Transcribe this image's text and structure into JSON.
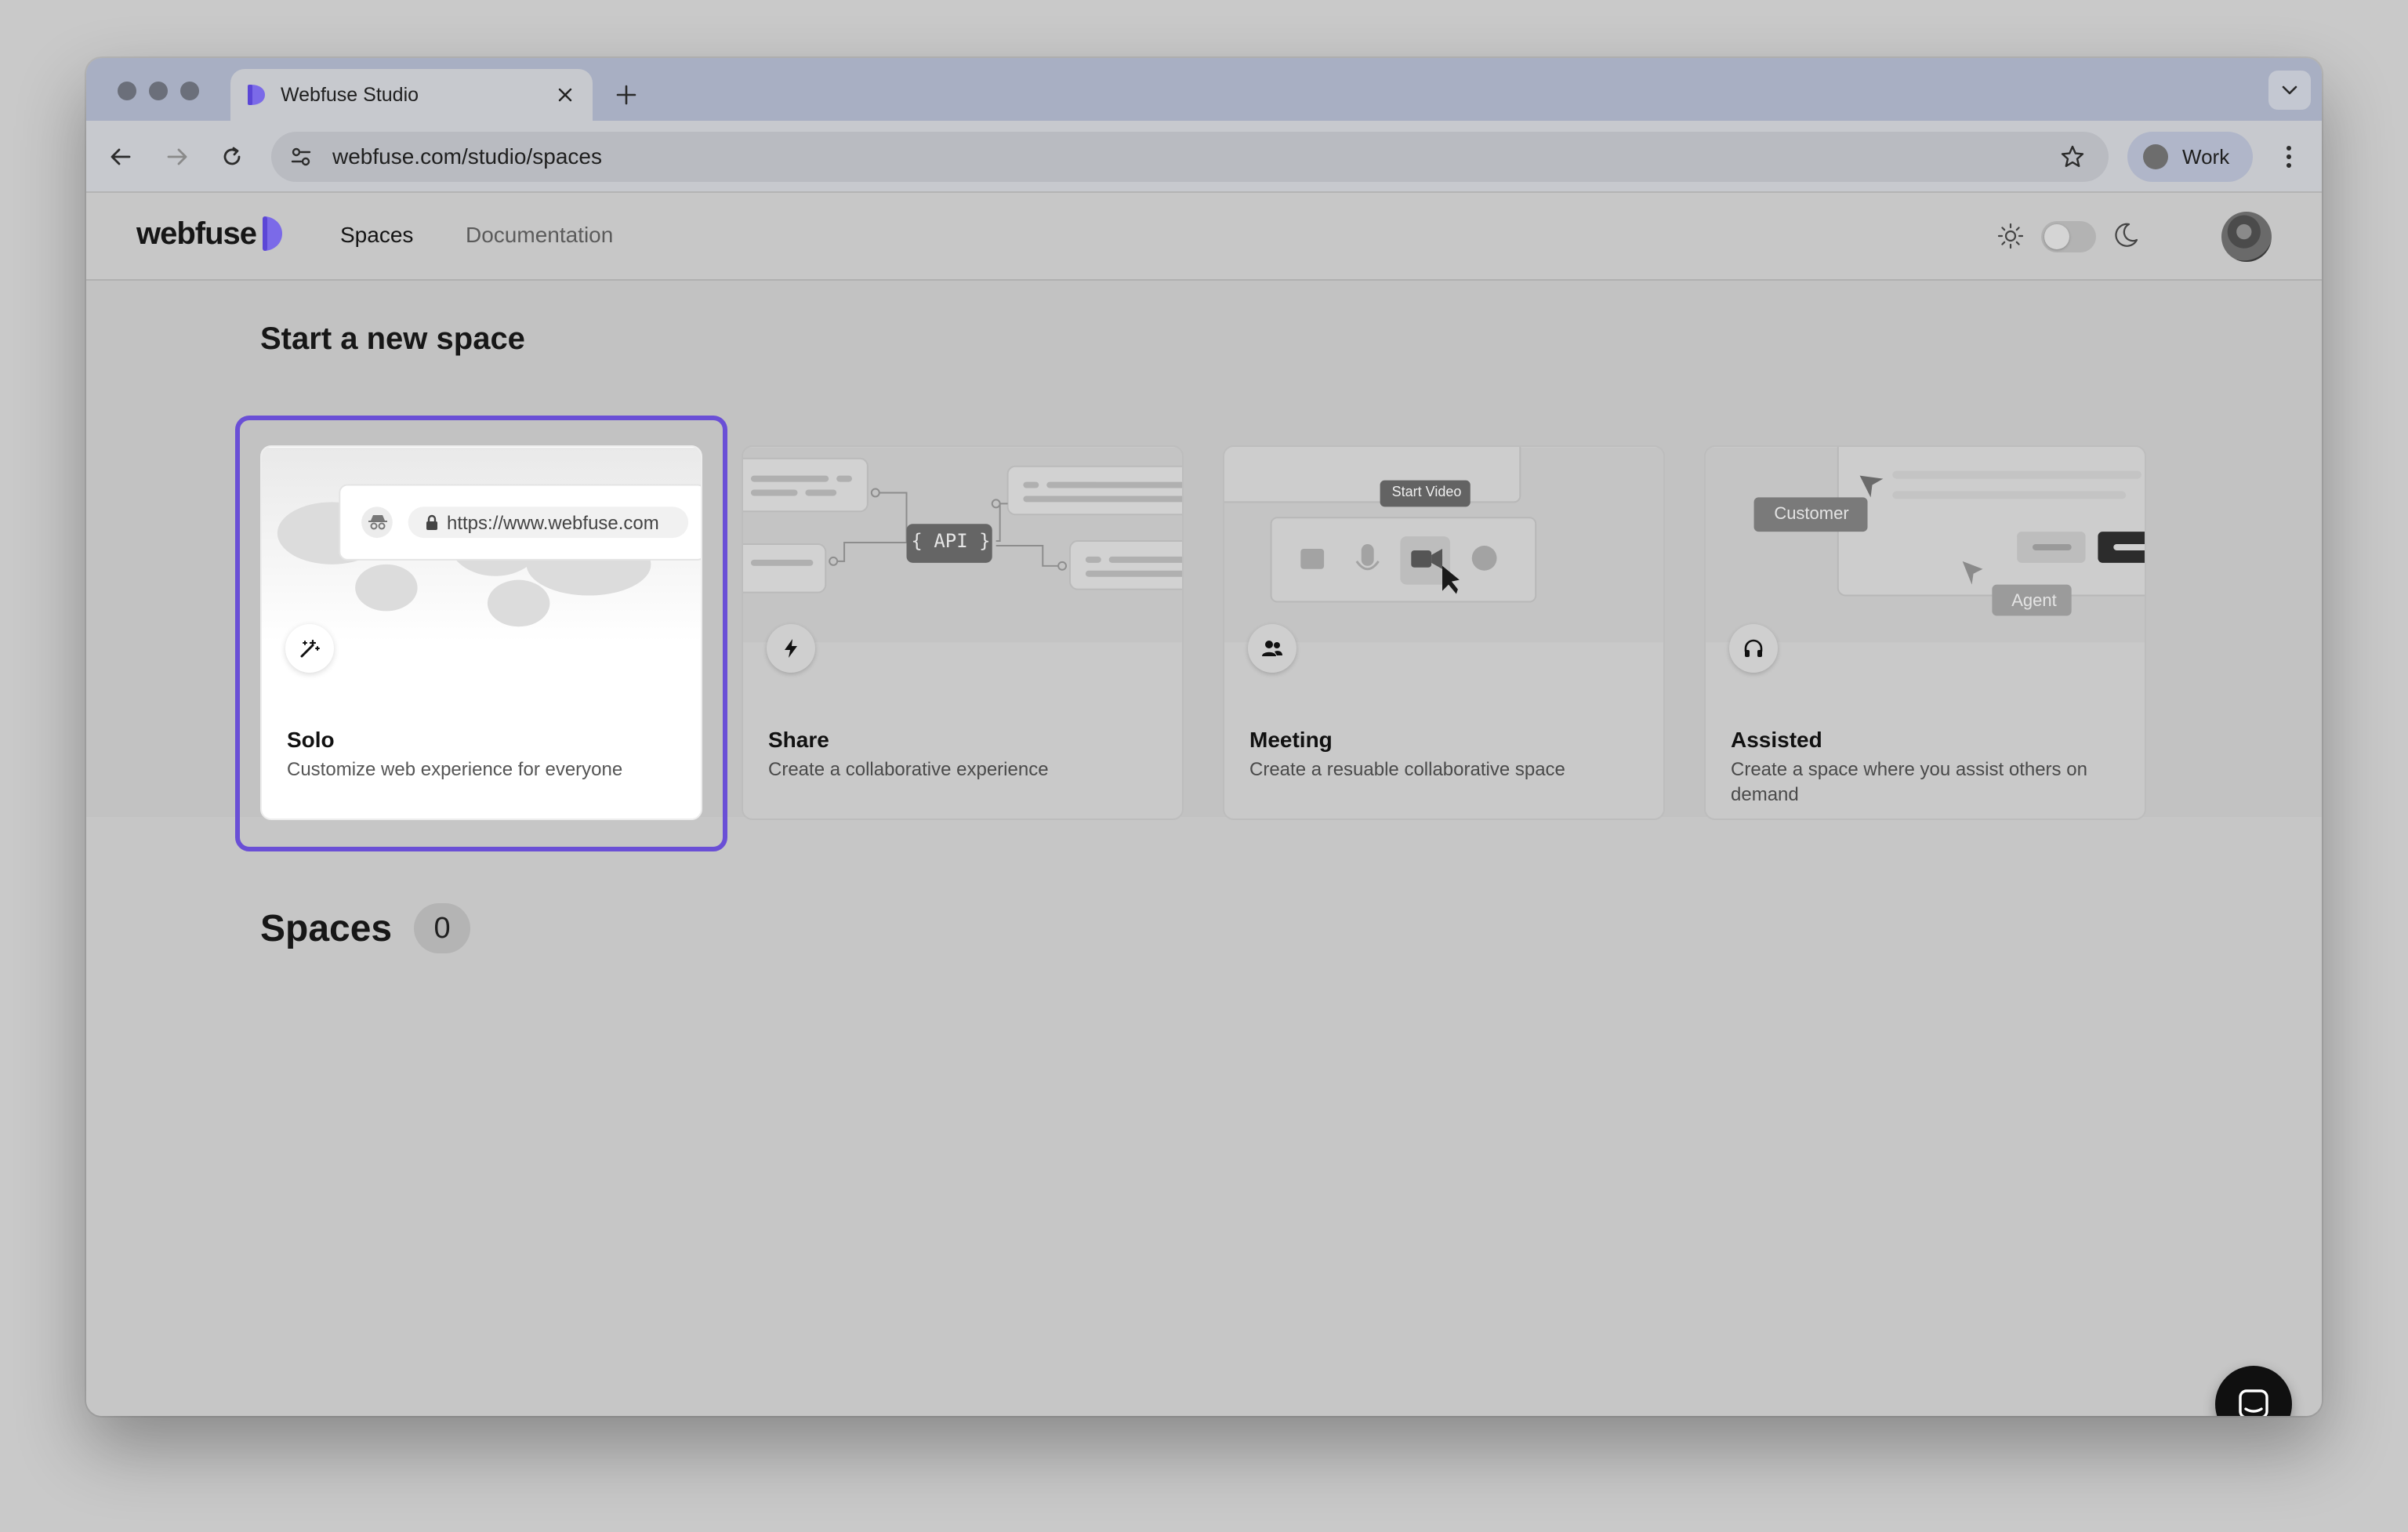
{
  "browser": {
    "tab_title": "Webfuse Studio",
    "url": "webfuse.com/studio/spaces",
    "profile_label": "Work"
  },
  "app": {
    "logo_text": "webfuse",
    "nav": {
      "spaces": "Spaces",
      "documentation": "Documentation"
    }
  },
  "new_space": {
    "title": "Start a new space",
    "cards": [
      {
        "title": "Solo",
        "description": "Customize web experience for everyone",
        "icon": "magic-wand-icon",
        "illustration": {
          "url": "https://www.webfuse.com"
        },
        "selected": true
      },
      {
        "title": "Share",
        "description": "Create a collaborative experience",
        "icon": "lightning-icon",
        "illustration": {
          "badge": "{ API }"
        }
      },
      {
        "title": "Meeting",
        "description": "Create a resuable collaborative space",
        "icon": "users-icon",
        "illustration": {
          "tooltip": "Start Video"
        }
      },
      {
        "title": "Assisted",
        "description": "Create a space where you assist others on demand",
        "icon": "headphones-icon",
        "illustration": {
          "label_customer": "Customer",
          "label_agent": "Agent"
        }
      }
    ]
  },
  "spaces": {
    "title": "Spaces",
    "count": "0"
  },
  "colors": {
    "highlight": "#6a4fd6",
    "logo_accent": "#7b6ae8"
  }
}
